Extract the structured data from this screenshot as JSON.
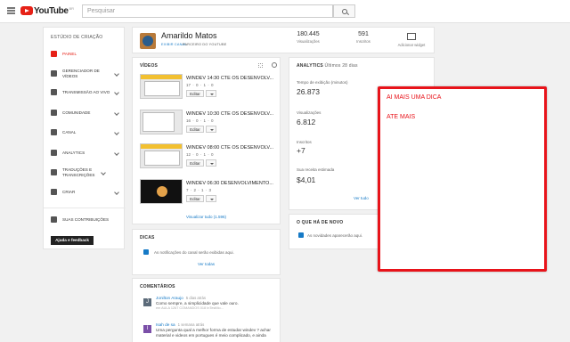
{
  "header": {
    "logo_text": "YouTube",
    "logo_country": "BR",
    "search_placeholder": "Pesquisar"
  },
  "sidebar": {
    "title": "ESTÚDIO DE CRIAÇÃO",
    "items": [
      {
        "label": "PAINEL",
        "icon": "dashboard-icon",
        "active": true
      },
      {
        "label": "GERENCIADOR DE VÍDEOS",
        "icon": "video-manager-icon"
      },
      {
        "label": "TRANSMISSÃO AO VIVO",
        "icon": "live-icon"
      },
      {
        "label": "COMUNIDADE",
        "icon": "community-icon"
      },
      {
        "label": "CANAL",
        "icon": "channel-icon"
      },
      {
        "label": "ANALYTICS",
        "icon": "analytics-icon"
      },
      {
        "label": "TRADUÇÕES E TRANSCRIÇÕES",
        "icon": "translate-icon"
      },
      {
        "label": "CRIAR",
        "icon": "create-icon"
      }
    ],
    "contributions": "SUAS CONTRIBUIÇÕES",
    "help_button": "Ajuda e feedback"
  },
  "channel": {
    "name": "Amarildo Matos",
    "view_channel": "EXIBIR CANAL",
    "partner": "PARCEIRO DO YOUTUBE",
    "views_value": "180.445",
    "views_label": "Visualizações",
    "subs_value": "591",
    "subs_label": "Inscritos",
    "add_widget": "Adicionar widget"
  },
  "videos": {
    "title": "VÍDEOS",
    "items": [
      {
        "title": "WINDEV 14:30 CTE OS DESENVOLV...",
        "meta": "17 · 0 · 1 · 0"
      },
      {
        "title": "WINDEV 10:30 CTE OS DESENVOLV...",
        "meta": "16 · 0 · 1 · 0"
      },
      {
        "title": "WINDEV 08:00 CTE OS DESENVOLV...",
        "meta": "12 · 0 · 1 · 0"
      },
      {
        "title": "WINDEV 06:30 DESENVOLVIMENTO...",
        "meta": "7 · 2 · 1 · 3"
      }
    ],
    "edit_label": "Editar",
    "view_all": "Visualizar tudo (1.596)"
  },
  "tips": {
    "title": "DICAS",
    "text": "As notificações do canal serão exibidas aqui.",
    "view_all": "Ver todas"
  },
  "comments": {
    "title": "COMENTÁRIOS",
    "items": [
      {
        "initial": "J",
        "name": "Jonilton Araujo",
        "date": "5 dias atrás",
        "text": "Como sempre, a simplicidade que vale ouro.",
        "sub": "em AULA 1267 COMANDOS 018 InTestMo...",
        "color": "#5c6b7a"
      },
      {
        "initial": "I",
        "name": "Isah de sa",
        "date": "1 semana atrás",
        "text": "Uma pergunta qual a melhor forma de estudar windev ? achar material e videos em portugues é meio complicado, e ainda",
        "sub": "",
        "color": "#7b4fa8"
      }
    ]
  },
  "analytics": {
    "title": "ANALYTICS",
    "subtitle": "Últimos 28 dias",
    "metrics": [
      {
        "label": "Tempo de exibição (minutos)",
        "value": "26.873"
      },
      {
        "label": "Visualizações",
        "value": "6.812"
      },
      {
        "label": "Inscritos",
        "value": "+7"
      },
      {
        "label": "Sua receita estimada",
        "value": "$4,01"
      }
    ],
    "view_all": "Ver tudo"
  },
  "news": {
    "title": "O QUE HÁ DE NOVO",
    "text": "As novidades aparecerão aqui."
  },
  "callout": {
    "line1": "AI MAIS UMA DICA",
    "line2": "ATE MAIS",
    "border_color": "#e8131a"
  }
}
